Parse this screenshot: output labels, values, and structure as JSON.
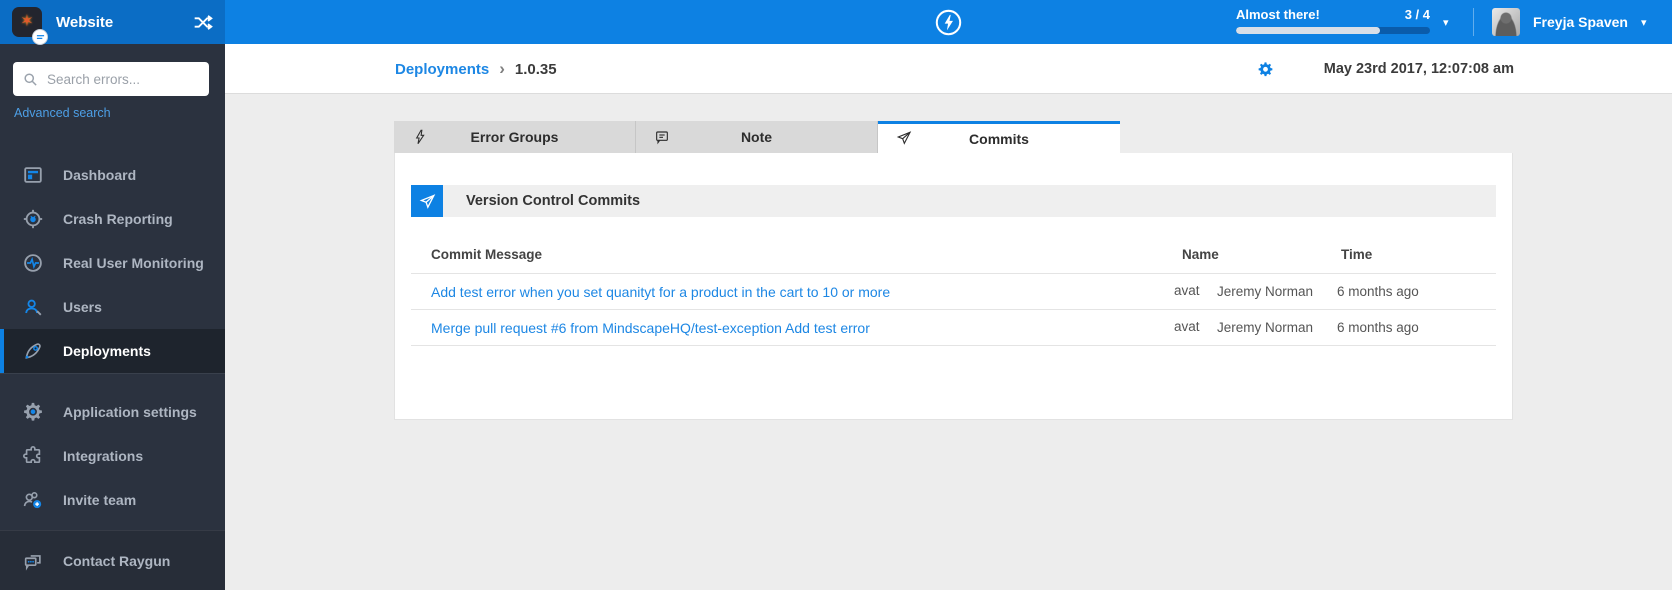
{
  "topbar": {
    "app_name": "Website",
    "onboarding": {
      "label": "Almost there!",
      "progress_label": "3 / 4",
      "completed": 3,
      "total": 4,
      "percent": 74
    },
    "user_name": "Freyja Spaven"
  },
  "sidebar": {
    "search_placeholder": "Search errors...",
    "advanced_search_label": "Advanced search",
    "items": [
      {
        "label": "Dashboard",
        "icon": "dashboard-icon",
        "active": false
      },
      {
        "label": "Crash Reporting",
        "icon": "crash-reporting-icon",
        "active": false
      },
      {
        "label": "Real User Monitoring",
        "icon": "real-user-monitoring-icon",
        "active": false
      },
      {
        "label": "Users",
        "icon": "users-icon",
        "active": false
      },
      {
        "label": "Deployments",
        "icon": "rocket-icon",
        "active": true
      },
      {
        "label": "Application settings",
        "icon": "gear-icon",
        "active": false
      },
      {
        "label": "Integrations",
        "icon": "puzzle-icon",
        "active": false
      },
      {
        "label": "Invite team",
        "icon": "invite-team-icon",
        "active": false
      },
      {
        "label": "Contact Raygun",
        "icon": "chat-bubbles-icon",
        "active": false
      }
    ]
  },
  "header": {
    "breadcrumb_parent": "Deployments",
    "breadcrumb_separator": "›",
    "breadcrumb_current": "1.0.35",
    "datetime": "May 23rd 2017, 12:07:08 am"
  },
  "tabs": [
    {
      "label": "Error Groups",
      "icon": "lightning-icon",
      "active": false
    },
    {
      "label": "Note",
      "icon": "note-icon",
      "active": false
    },
    {
      "label": "Commits",
      "icon": "paper-plane-icon",
      "active": true
    }
  ],
  "panel": {
    "section_title": "Version Control Commits",
    "table": {
      "columns": [
        "Commit Message",
        "Name",
        "Time"
      ],
      "rows": [
        {
          "message": "Add test error when you set quanityt for a product in the cart to 10 or more",
          "avatar_alt": "avatar",
          "name": "Jeremy Norman",
          "time": "6 months ago"
        },
        {
          "message": "Merge pull request #6 from MindscapeHQ/test-exception Add test error",
          "avatar_alt": "avatar",
          "name": "Jeremy Norman",
          "time": "6 months ago"
        }
      ]
    }
  },
  "colors": {
    "accent_blue": "#0d81e3",
    "topbar_left_blue": "#0b6dc5",
    "sidebar_bg": "#2b323f",
    "sidebar_active_bg": "#1e242d",
    "link_blue": "#1d87e4",
    "content_bg": "#ededed",
    "tab_inactive_bg": "#d9d9d9",
    "progress_track": "#0a5cab",
    "progress_fill": "#d8dfe8"
  }
}
